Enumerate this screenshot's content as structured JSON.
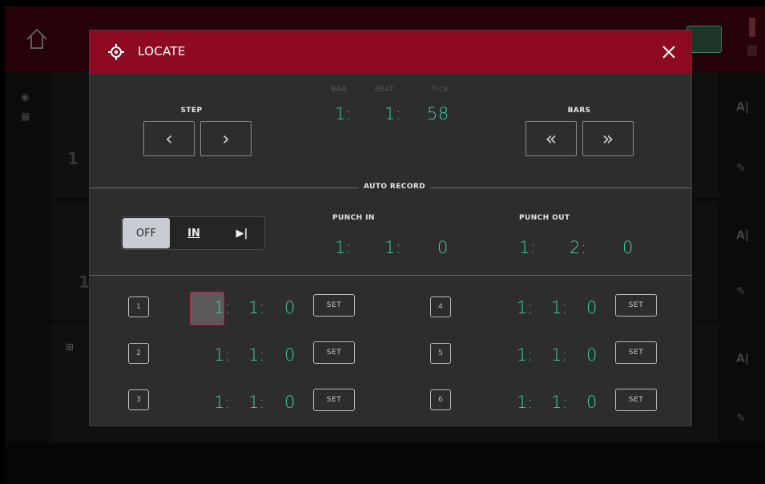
{
  "dialog": {
    "title": "LOCATE",
    "step_label": "STEP",
    "bars_label": "BARS",
    "position_headers": {
      "bar": "BAR",
      "beat": "BEAT",
      "tick": "TICK"
    },
    "position": {
      "bar": "1:",
      "beat": "1:",
      "tick": "58"
    },
    "step_prev": "‹",
    "step_next": "›",
    "bars_prev": "«",
    "bars_next": "»",
    "auto_record_label": "AUTO RECORD",
    "mode_options": [
      "OFF",
      "IN",
      "▶|"
    ],
    "mode_selected": "OFF",
    "punch_in": {
      "label": "PUNCH IN",
      "bar": "1:",
      "beat": "1:",
      "tick": "0"
    },
    "punch_out": {
      "label": "PUNCH OUT",
      "bar": "1:",
      "beat": "2:",
      "tick": "0"
    },
    "set_label": "SET",
    "markers": [
      {
        "num": "1",
        "bar": "1:",
        "beat": "1:",
        "tick": "0"
      },
      {
        "num": "2",
        "bar": "1:",
        "beat": "1:",
        "tick": "0"
      },
      {
        "num": "3",
        "bar": "1:",
        "beat": "1:",
        "tick": "0"
      },
      {
        "num": "4",
        "bar": "1:",
        "beat": "1:",
        "tick": "0"
      },
      {
        "num": "5",
        "bar": "1:",
        "beat": "1:",
        "tick": "0"
      },
      {
        "num": "6",
        "bar": "1:",
        "beat": "1:",
        "tick": "0"
      }
    ]
  },
  "background": {
    "track_number_1": "1",
    "track_number_2": "1"
  },
  "colors": {
    "header": "#8d0a22",
    "accent_value": "#3fcfa6",
    "dialog_bg": "#2d2d2e",
    "selected_marker_border": "#d12040"
  },
  "icons": {
    "header": "crosshair-target-icon",
    "close": "close-icon",
    "home": "home-icon"
  }
}
